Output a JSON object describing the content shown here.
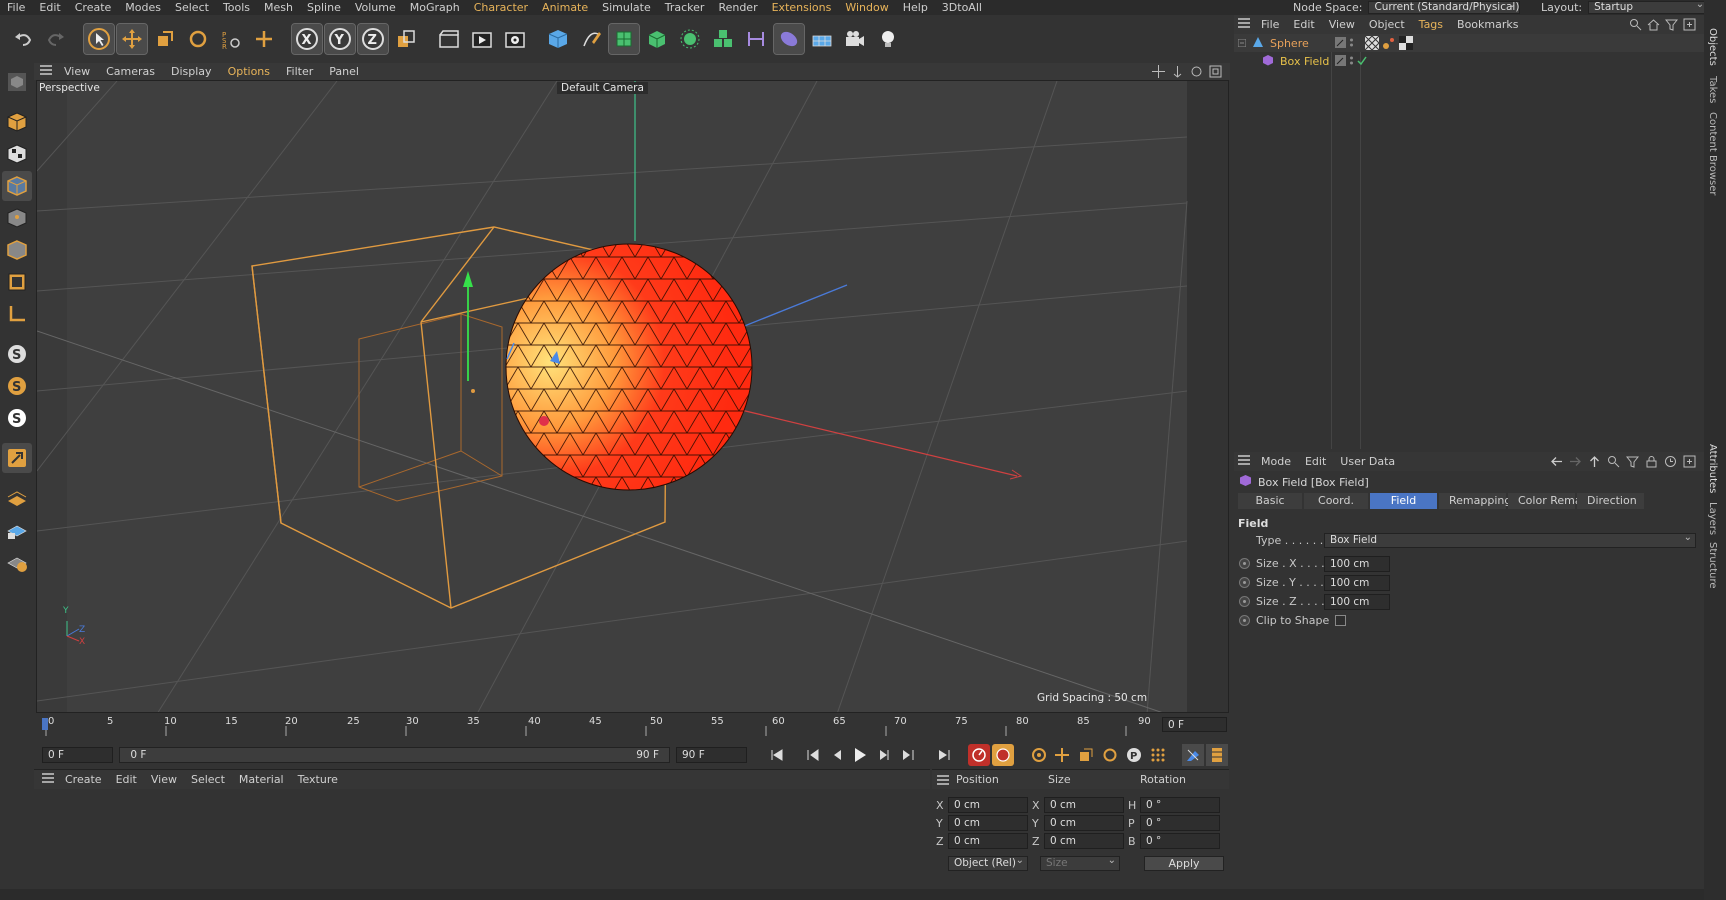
{
  "menubar": {
    "items": [
      "File",
      "Edit",
      "Create",
      "Modes",
      "Select",
      "Tools",
      "Mesh",
      "Spline",
      "Volume",
      "MoGraph",
      "Character",
      "Animate",
      "Simulate",
      "Tracker",
      "Render",
      "Extensions",
      "Window",
      "Help",
      "3DtoAll"
    ],
    "node_space_label": "Node Space:",
    "node_space_value": "Current (Standard/Physical)",
    "layout_label": "Layout:",
    "layout_value": "Startup"
  },
  "viewport_menu": [
    "View",
    "Cameras",
    "Display",
    "Options",
    "Filter",
    "Panel"
  ],
  "viewport": {
    "view_name": "Perspective",
    "camera_name": "Default Camera",
    "grid_spacing": "Grid Spacing : 50 cm"
  },
  "timeline": {
    "ticks": [
      "0",
      "5",
      "10",
      "15",
      "20",
      "25",
      "30",
      "35",
      "40",
      "45",
      "50",
      "55",
      "60",
      "65",
      "70",
      "75",
      "80",
      "85",
      "90"
    ],
    "current_frame_display": "0 F",
    "start_field": "0 F",
    "range_start": "0 F",
    "range_end": "90 F",
    "end_field": "90 F"
  },
  "material_menu": [
    "Create",
    "Edit",
    "View",
    "Select",
    "Material",
    "Texture"
  ],
  "coords": {
    "headers": {
      "position": "Position",
      "size": "Size",
      "rotation": "Rotation"
    },
    "rows": [
      {
        "axis": "X",
        "pos": "0 cm",
        "saxis": "X",
        "size": "0 cm",
        "raxis": "H",
        "rot": "0 °"
      },
      {
        "axis": "Y",
        "pos": "0 cm",
        "saxis": "Y",
        "size": "0 cm",
        "raxis": "P",
        "rot": "0 °"
      },
      {
        "axis": "Z",
        "pos": "0 cm",
        "saxis": "Z",
        "size": "0 cm",
        "raxis": "B",
        "rot": "0 °"
      }
    ],
    "mode_select": "Object (Rel)",
    "size_select": "Size",
    "apply_label": "Apply"
  },
  "objects_menu": [
    "File",
    "Edit",
    "View",
    "Object",
    "Tags",
    "Bookmarks"
  ],
  "objects": [
    {
      "name": "Sphere",
      "color": "#e8a15a"
    },
    {
      "name": "Box Field",
      "color": "#e8c24a"
    }
  ],
  "attributes": {
    "menu": [
      "Mode",
      "Edit",
      "User Data"
    ],
    "title": "Box Field [Box Field]",
    "tabs": [
      "Basic",
      "Coord.",
      "Field",
      "Remapping",
      "Color Remap",
      "Direction"
    ],
    "active_tab": "Field",
    "section": "Field",
    "type_label": "Type . . . . . .",
    "type_value": "Box Field",
    "params": [
      {
        "label": "Size . X . . . . .",
        "value": "100 cm"
      },
      {
        "label": "Size . Y . . . . .",
        "value": "100 cm"
      },
      {
        "label": "Size . Z . . . . .",
        "value": "100 cm"
      }
    ],
    "clip_label": "Clip to Shape"
  },
  "side_tabs": [
    "Objects",
    "Takes",
    "Content Browser",
    "Attributes",
    "Layers",
    "Structure"
  ],
  "colors": {
    "accent": "#4a75c4",
    "box": "#e09a40",
    "sphere": "#ff2a10",
    "menu_accent": "#e8b45a"
  }
}
